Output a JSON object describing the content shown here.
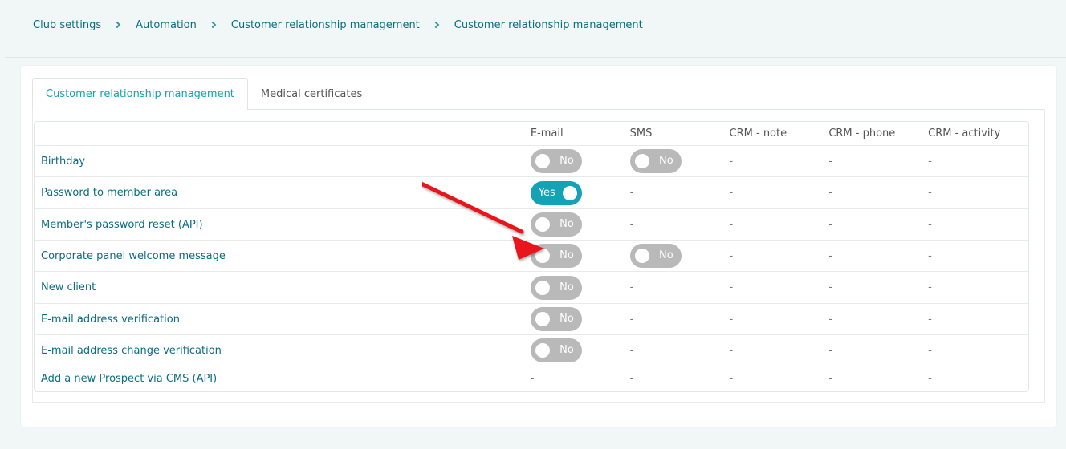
{
  "breadcrumb": [
    "Club settings",
    "Automation",
    "Customer relationship management",
    "Customer relationship management"
  ],
  "tabs": [
    "Customer relationship management",
    "Medical certificates"
  ],
  "table": {
    "columns": [
      "E-mail",
      "SMS",
      "CRM - note",
      "CRM - phone",
      "CRM - activity"
    ],
    "rows": [
      {
        "label": "Birthday",
        "email": "No",
        "sms": "No",
        "note": "-",
        "phone": "-",
        "activity": "-"
      },
      {
        "label": "Password to member area",
        "email": "Yes",
        "sms": "-",
        "note": "-",
        "phone": "-",
        "activity": "-"
      },
      {
        "label": "Member's password reset (API)",
        "email": "No",
        "sms": "-",
        "note": "-",
        "phone": "-",
        "activity": "-"
      },
      {
        "label": "Corporate panel welcome message",
        "email": "No",
        "sms": "No",
        "note": "-",
        "phone": "-",
        "activity": "-"
      },
      {
        "label": "New client",
        "email": "No",
        "sms": "-",
        "note": "-",
        "phone": "-",
        "activity": "-"
      },
      {
        "label": "E-mail address verification",
        "email": "No",
        "sms": "-",
        "note": "-",
        "phone": "-",
        "activity": "-"
      },
      {
        "label": "E-mail address change verification",
        "email": "No",
        "sms": "-",
        "note": "-",
        "phone": "-",
        "activity": "-"
      },
      {
        "label": "Add a new Prospect via CMS (API)",
        "email": "-",
        "sms": "-",
        "note": "-",
        "phone": "-",
        "activity": "-"
      }
    ]
  },
  "colors": {
    "accent": "#13a2b6",
    "toggle_off": "#b9b9b9",
    "link": "#0b6e80",
    "annotation_arrow": "#e8141c"
  }
}
